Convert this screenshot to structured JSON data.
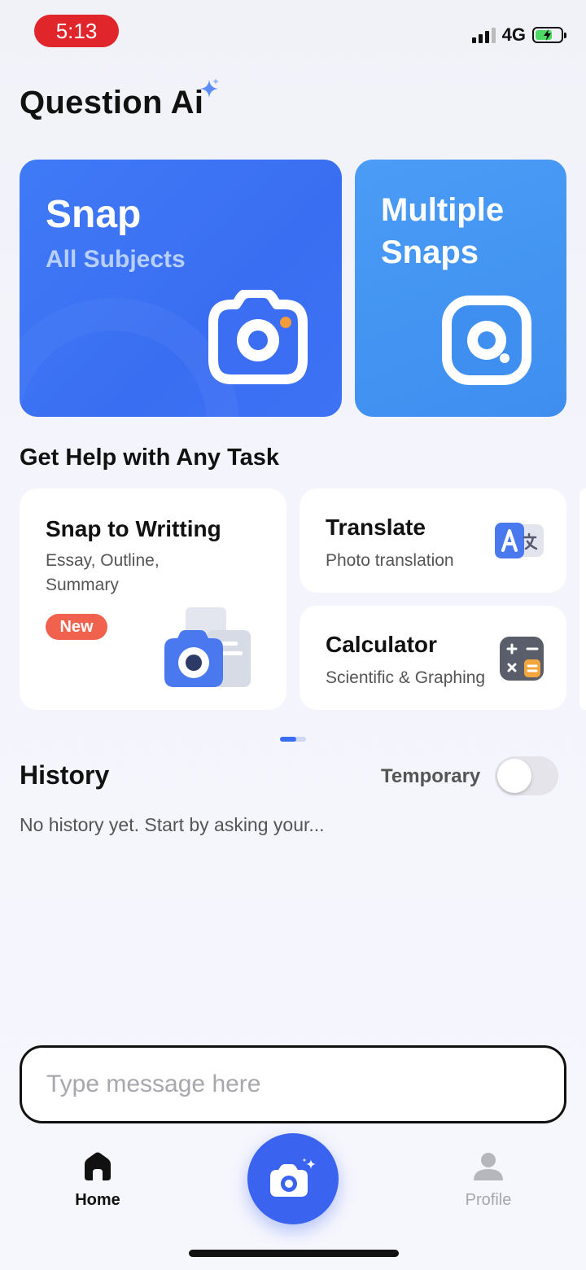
{
  "status_bar": {
    "time": "5:13",
    "network": "4G"
  },
  "app": {
    "title": "Question Ai"
  },
  "snap_card": {
    "title": "Snap",
    "subtitle": "All Subjects"
  },
  "multi_card": {
    "title": "Multiple Snaps"
  },
  "tasks": {
    "section_title": "Get Help with Any Task",
    "writing": {
      "title": "Snap to Writting",
      "subtitle_line1": "Essay, Outline,",
      "subtitle_line2": "Summary",
      "badge": "New"
    },
    "translate": {
      "title": "Translate",
      "subtitle": "Photo translation"
    },
    "calculator": {
      "title": "Calculator",
      "subtitle": "Scientific & Graphing"
    }
  },
  "history": {
    "title": "History",
    "temporary_label": "Temporary",
    "temporary_on": false,
    "empty_text": "No history yet. Start by asking your..."
  },
  "composer": {
    "placeholder": "Type message here"
  },
  "nav": {
    "home_label": "Home",
    "profile_label": "Profile"
  },
  "colors": {
    "accent": "#3a63f0",
    "badge": "#f0624d",
    "status_time_bg": "#e0262b"
  }
}
